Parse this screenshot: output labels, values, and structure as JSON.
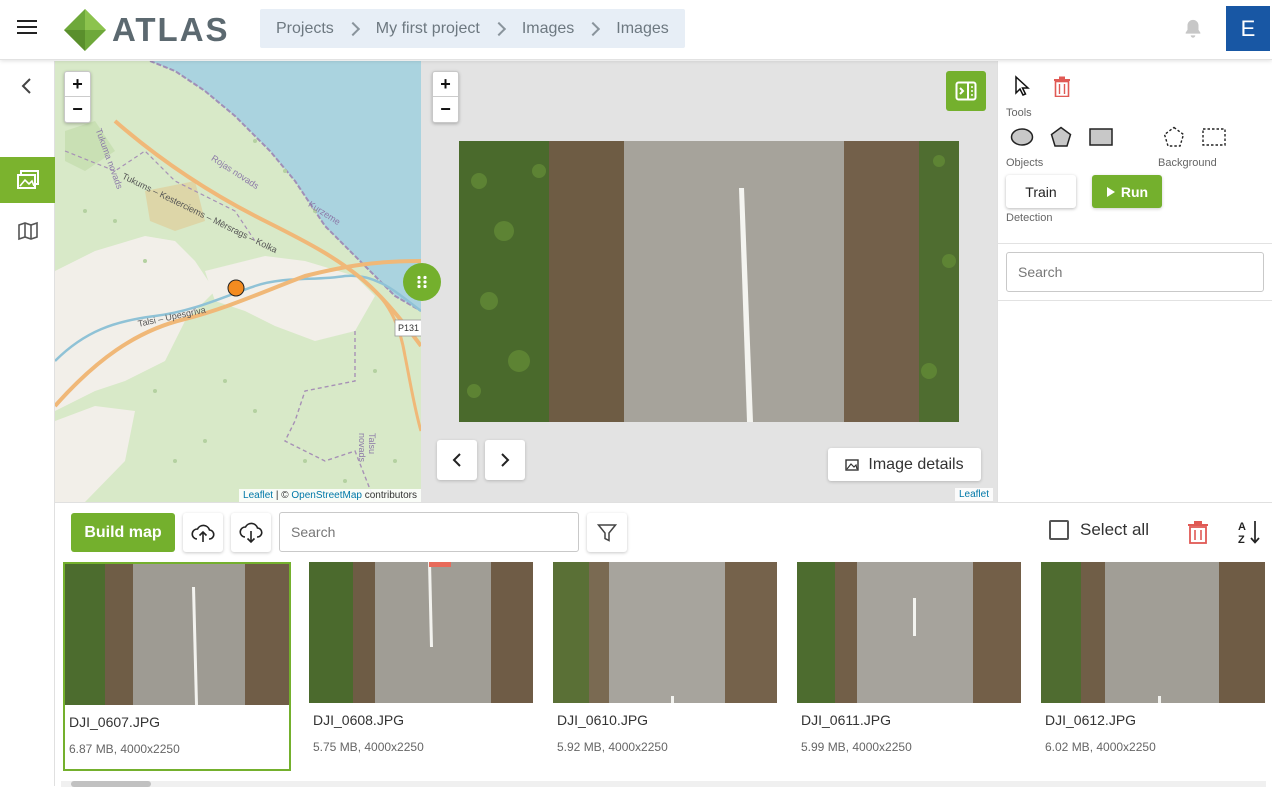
{
  "header": {
    "app_name": "ATLAS",
    "breadcrumb": [
      "Projects",
      "My first project",
      "Images",
      "Images"
    ],
    "user_initial": "E"
  },
  "rail": {
    "items": [
      "back-icon",
      "images-icon",
      "map-icon"
    ],
    "active": "images"
  },
  "map": {
    "zoom_in": "+",
    "zoom_out": "−",
    "labels": [
      "Tukums – Kesterciems – Mērsrags – Kolka",
      "Rojas novads",
      "Kurzeme",
      "Talsi – Upesgrīva",
      "P131",
      "Talsu novads",
      "Tukuma novads"
    ],
    "attribution_leaflet": "Leaflet",
    "attribution_sep": " | © ",
    "attribution_osm": "OpenStreetMap",
    "attribution_contrib": " contributors"
  },
  "viewer": {
    "zoom_in": "+",
    "zoom_out": "−",
    "image_details_label": "Image details",
    "attribution": "Leaflet"
  },
  "tools": {
    "tools_label": "Tools",
    "objects_label": "Objects",
    "background_label": "Background",
    "detection_label": "Detection",
    "train_label": "Train",
    "run_label": "Run",
    "search_placeholder": "Search"
  },
  "bottom": {
    "build_map_label": "Build map",
    "search_placeholder": "Search",
    "select_all_label": "Select all"
  },
  "thumbnails": [
    {
      "name": "DJI_0607.JPG",
      "meta": "6.87 MB, 4000x2250",
      "selected": true
    },
    {
      "name": "DJI_0608.JPG",
      "meta": "5.75 MB, 4000x2250",
      "selected": false
    },
    {
      "name": "DJI_0610.JPG",
      "meta": "5.92 MB, 4000x2250",
      "selected": false
    },
    {
      "name": "DJI_0611.JPG",
      "meta": "5.99 MB, 4000x2250",
      "selected": false
    },
    {
      "name": "DJI_0612.JPG",
      "meta": "6.02 MB, 4000x2250",
      "selected": false
    }
  ],
  "colors": {
    "accent": "#74b02d",
    "user": "#1857a4",
    "danger": "#e05a55",
    "breadcrumb_bg": "#e7eef6"
  }
}
